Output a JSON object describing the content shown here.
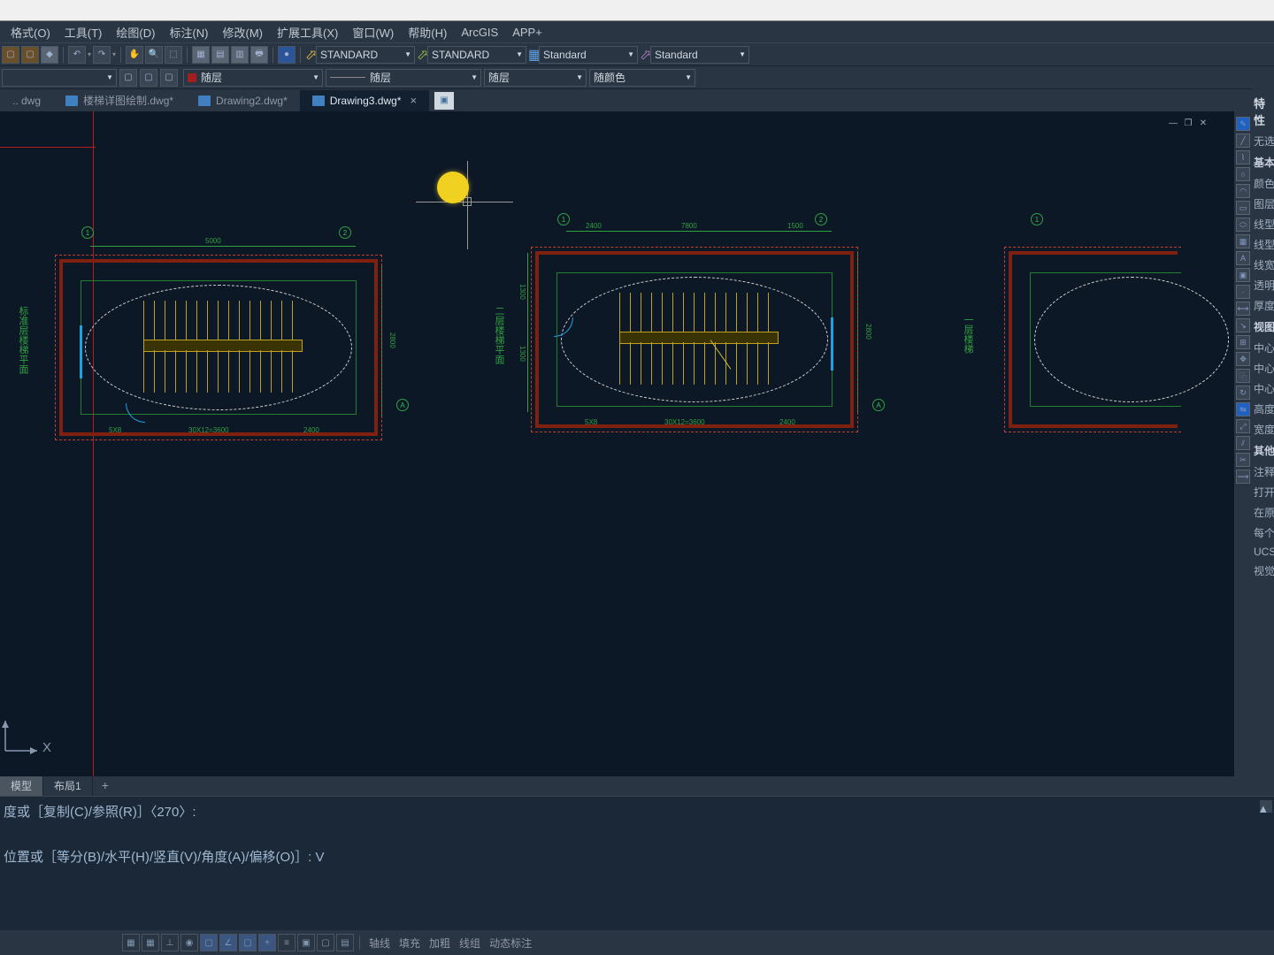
{
  "menus": [
    "格式(O)",
    "工具(T)",
    "绘图(D)",
    "标注(N)",
    "修改(M)",
    "扩展工具(X)",
    "窗口(W)",
    "帮助(H)",
    "ArcGIS",
    "APP+"
  ],
  "styleCombos": {
    "s1": "STANDARD",
    "s2": "STANDARD",
    "s3": "Standard",
    "s4": "Standard"
  },
  "layerCombos": {
    "current": "随层",
    "lt": "随层",
    "lw": "随层",
    "color": "随颜色"
  },
  "tabs": [
    {
      "label": ".. dwg",
      "active": false,
      "dirty": false
    },
    {
      "label": "楼梯详图绘制.dwg*",
      "active": false,
      "dirty": true
    },
    {
      "label": "Drawing2.dwg*",
      "active": false,
      "dirty": true
    },
    {
      "label": "Drawing3.dwg*",
      "active": true,
      "dirty": true
    }
  ],
  "viewTabs": {
    "model": "模型",
    "layout1": "布局1"
  },
  "properties": {
    "title": "特性",
    "noSelection": "无选!",
    "section1": "基本",
    "rows1": [
      "颜色",
      "图层",
      "线型",
      "线型!",
      "线宽",
      "透明!",
      "厚度"
    ],
    "section2": "视图",
    "rows2": [
      "中心",
      "中心",
      "中心",
      "高度",
      "宽度"
    ],
    "section3": "其他",
    "rows3": [
      "注释!",
      "打开",
      "在原!",
      "每个!",
      "UCS",
      "视觉"
    ]
  },
  "cmd": {
    "line1": "度或［复制(C)/参照(R)］〈270〉:",
    "line2": "位置或［等分(B)/水平(H)/竖直(V)/角度(A)/偏移(O)］: V"
  },
  "status": {
    "btnsL": [
      "轴线",
      "填充",
      "加粗",
      "线组",
      "动态标注"
    ]
  },
  "axis": {
    "x": "X"
  },
  "plan": {
    "dim_top": "5000",
    "dim_top_span1": "2400",
    "dim_top_span2": "7800",
    "dim_top_span3": "1500",
    "dim_left": "2800",
    "dim_left2": "1300",
    "dim_left3": "1300",
    "dim_right": "2800",
    "dim_bot1": "5X8",
    "dim_bot2": "30X12=3600",
    "dim_bot3": "2400",
    "labelA": "标准层楼梯平面",
    "labelB": "二层楼梯平面",
    "labelC": "一层楼梯"
  }
}
